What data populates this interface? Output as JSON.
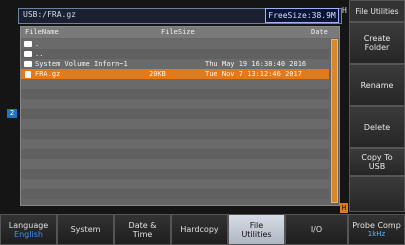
{
  "path": "USB:/FRA.gz",
  "free_size": "FreeSize:38.9M",
  "top_h_marker": "H",
  "channel_marker": "2",
  "h_marker": "H",
  "browser": {
    "col_filename": "FileName",
    "col_filesize": "FileSize",
    "col_date": "Date",
    "rows": [
      {
        "name": ".",
        "size": "",
        "date": "",
        "folder": true
      },
      {
        "name": "..",
        "size": "",
        "date": "",
        "folder": true
      },
      {
        "name": "System Volume Inforn~1",
        "size": "",
        "date": "Thu May 19 16:38:40 2016",
        "folder": true
      },
      {
        "name": "FRA.gz",
        "size": "20KB",
        "date": "Tue Nov  7 13:12:46 2017",
        "selected": true,
        "folder": false
      }
    ]
  },
  "right_menu": {
    "title": "File Utilities",
    "create": "Create\nFolder",
    "rename": "Rename",
    "delete": "Delete",
    "copy_to_usb": "Copy To\nUSB"
  },
  "bottom_menu": {
    "language_label": "Language",
    "language_value": "English",
    "system": "System",
    "date_time_line1": "Date &",
    "date_time_line2": "Time",
    "hardcopy": "Hardcopy",
    "file_utilities_line1": "File",
    "file_utilities_line2": "Utilities",
    "io": "I/O",
    "probe_comp": "Probe Comp",
    "probe_comp_value": "1kHz"
  }
}
